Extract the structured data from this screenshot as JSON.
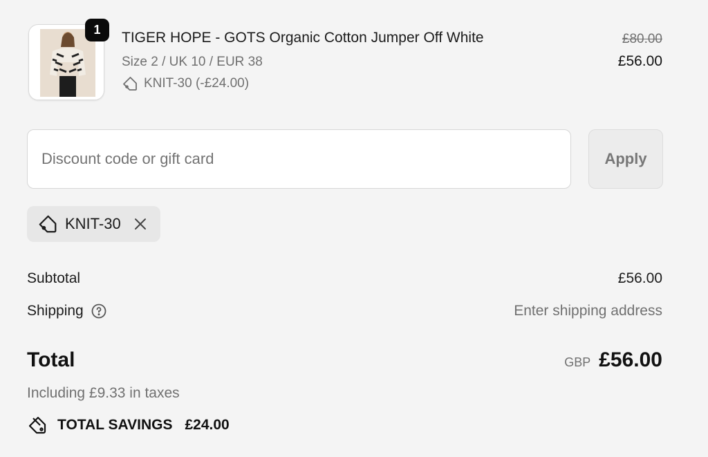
{
  "product": {
    "quantity": "1",
    "title": "TIGER HOPE - GOTS Organic Cotton Jumper Off White",
    "variant": "Size 2 / UK 10 / EUR 38",
    "discount_line": "KNIT-30 (-£24.00)",
    "price_original": "£80.00",
    "price_final": "£56.00",
    "image_icon": "sweater-model-photo"
  },
  "discount": {
    "placeholder": "Discount code or gift card",
    "value": "",
    "apply_label": "Apply"
  },
  "applied_code": {
    "label": "KNIT-30",
    "tag_icon": "tag-icon",
    "remove_icon": "close-icon"
  },
  "summary": {
    "subtotal_label": "Subtotal",
    "subtotal_value": "£56.00",
    "shipping_label": "Shipping",
    "shipping_value": "Enter shipping address",
    "total_label": "Total",
    "currency": "GBP",
    "total_value": "£56.00",
    "tax_note": "Including £9.33 in taxes",
    "savings_label": "TOTAL SAVINGS",
    "savings_value": "£24.00"
  },
  "colors": {
    "background": "#f4f4f4",
    "text": "#111111",
    "muted": "#707070",
    "badge": "#0a0a0a",
    "chip": "#e7e7e7"
  }
}
